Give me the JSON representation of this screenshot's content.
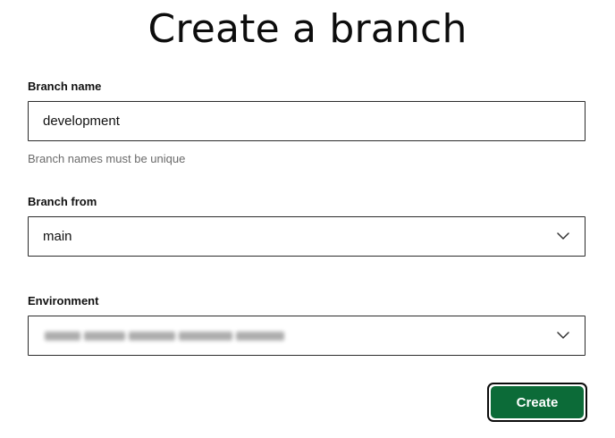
{
  "page": {
    "title": "Create a branch"
  },
  "branch_name": {
    "label": "Branch name",
    "value": "development",
    "helper": "Branch names must be unique"
  },
  "branch_from": {
    "label": "Branch from",
    "selected": "main",
    "icon": "chevron-down-icon"
  },
  "environment": {
    "label": "Environment",
    "selected_redacted": true,
    "icon": "chevron-down-icon"
  },
  "actions": {
    "create_label": "Create",
    "create_color": "#0c6b38"
  }
}
